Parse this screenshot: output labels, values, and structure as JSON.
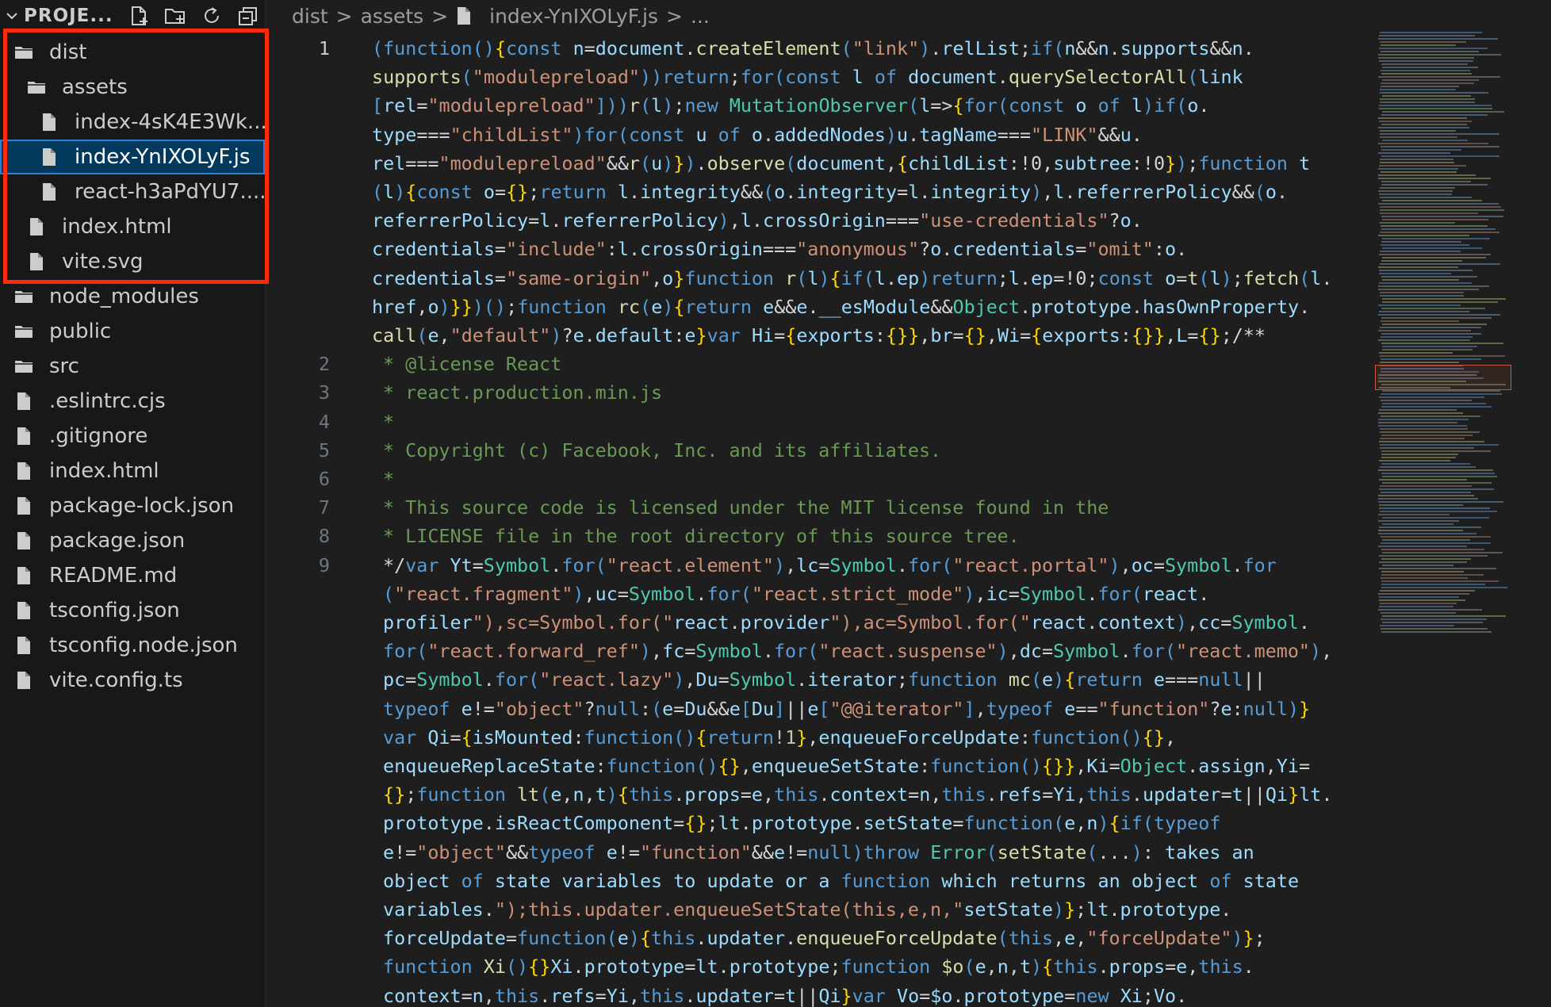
{
  "sidebar": {
    "title": "PROJE...",
    "actions": [
      "new-file-icon",
      "new-folder-icon",
      "refresh-icon",
      "collapse-all-icon"
    ],
    "items": [
      {
        "label": "dist",
        "type": "folder",
        "depth": 1
      },
      {
        "label": "assets",
        "type": "folder",
        "depth": 2
      },
      {
        "label": "index-4sK4E3Wk....",
        "type": "file",
        "depth": 3
      },
      {
        "label": "index-YnIXOLyF.js",
        "type": "file",
        "depth": 3,
        "selected": true
      },
      {
        "label": "react-h3aPdYU7....",
        "type": "file",
        "depth": 3
      },
      {
        "label": "index.html",
        "type": "file",
        "depth": 2
      },
      {
        "label": "vite.svg",
        "type": "file",
        "depth": 2
      },
      {
        "label": "node_modules",
        "type": "folder",
        "depth": 1
      },
      {
        "label": "public",
        "type": "folder",
        "depth": 1
      },
      {
        "label": "src",
        "type": "folder",
        "depth": 1
      },
      {
        "label": ".eslintrc.cjs",
        "type": "file",
        "depth": 1
      },
      {
        "label": ".gitignore",
        "type": "file",
        "depth": 1
      },
      {
        "label": "index.html",
        "type": "file",
        "depth": 1
      },
      {
        "label": "package-lock.json",
        "type": "file",
        "depth": 1
      },
      {
        "label": "package.json",
        "type": "file",
        "depth": 1
      },
      {
        "label": "README.md",
        "type": "file",
        "depth": 1
      },
      {
        "label": "tsconfig.json",
        "type": "file",
        "depth": 1
      },
      {
        "label": "tsconfig.node.json",
        "type": "file",
        "depth": 1
      },
      {
        "label": "vite.config.ts",
        "type": "file",
        "depth": 1
      }
    ]
  },
  "breadcrumb": {
    "parts": [
      "dist",
      "assets",
      "index-YnIXOLyF.js",
      "..."
    ],
    "separator": ">"
  },
  "editor": {
    "line_numbers": [
      "1",
      "2",
      "3",
      "4",
      "5",
      "6",
      "7",
      "8",
      "9"
    ],
    "lines": [
      "(function(){const n=document.createElement(\"link\").relList;if(n&&n.supports&&n.",
      "supports(\"modulepreload\"))return;for(const l of document.querySelectorAll('link",
      "[rel=\"modulepreload\"]'))r(l);new MutationObserver(l=>{for(const o of l)if(o.",
      "type===\"childList\")for(const u of o.addedNodes)u.tagName===\"LINK\"&&u.",
      "rel===\"modulepreload\"&&r(u)}).observe(document,{childList:!0,subtree:!0});function t",
      "(l){const o={};return l.integrity&&(o.integrity=l.integrity),l.referrerPolicy&&(o.",
      "referrerPolicy=l.referrerPolicy),l.crossOrigin===\"use-credentials\"?o.",
      "credentials=\"include\":l.crossOrigin===\"anonymous\"?o.credentials=\"omit\":o.",
      "credentials=\"same-origin\",o}function r(l){if(l.ep)return;l.ep=!0;const o=t(l);fetch(l.",
      "href,o)}})();function rc(e){return e&&e.__esModule&&Object.prototype.hasOwnProperty.",
      "call(e,\"default\")?e.default:e}var Hi={exports:{}},br={},Wi={exports:{}},L={};/**",
      "* @license React",
      "* react.production.min.js",
      "*",
      "* Copyright (c) Facebook, Inc. and its affiliates.",
      "*",
      "* This source code is licensed under the MIT license found in the",
      "* LICENSE file in the root directory of this source tree.",
      "*/var Yt=Symbol.for(\"react.element\"),lc=Symbol.for(\"react.portal\"),oc=Symbol.for",
      "(\"react.fragment\"),uc=Symbol.for(\"react.strict_mode\"),ic=Symbol.for(\"react.",
      "profiler\"),sc=Symbol.for(\"react.provider\"),ac=Symbol.for(\"react.context\"),cc=Symbol.",
      "for(\"react.forward_ref\"),fc=Symbol.for(\"react.suspense\"),dc=Symbol.for(\"react.memo\"),",
      "pc=Symbol.for(\"react.lazy\"),Du=Symbol.iterator;function mc(e){return e===null||",
      "typeof e!=\"object\"?null:(e=Du&&e[Du]||e[\"@@iterator\"],typeof e==\"function\"?e:null)}",
      "var Qi={isMounted:function(){return!1},enqueueForceUpdate:function(){},",
      "enqueueReplaceState:function(){},enqueueSetState:function(){}},Ki=Object.assign,Yi=",
      "{};function lt(e,n,t){this.props=e,this.context=n,this.refs=Yi,this.updater=t||Qi}lt.",
      "prototype.isReactComponent={};lt.prototype.setState=function(e,n){if(typeof",
      "e!=\"object\"&&typeof e!=\"function\"&&e!=null)throw Error(\"setState(...): takes an",
      "object of state variables to update or a function which returns an object of state",
      "variables.\");this.updater.enqueueSetState(this,e,n,\"setState\")};lt.prototype.",
      "forceUpdate=function(e){this.updater.enqueueForceUpdate(this,e,\"forceUpdate\")};",
      "function Xi(){}Xi.prototype=lt.prototype;function $o(e,n,t){this.props=e,this.",
      "context=n,this.refs=Yi,this.updater=t||Qi}var Vo=$o.prototype=new Xi;Vo."
    ]
  },
  "colors": {
    "sidebar_bg": "#181818",
    "editor_bg": "#1e1e1e",
    "selection": "#04395e",
    "highlight_box": "#ff2a0a"
  }
}
